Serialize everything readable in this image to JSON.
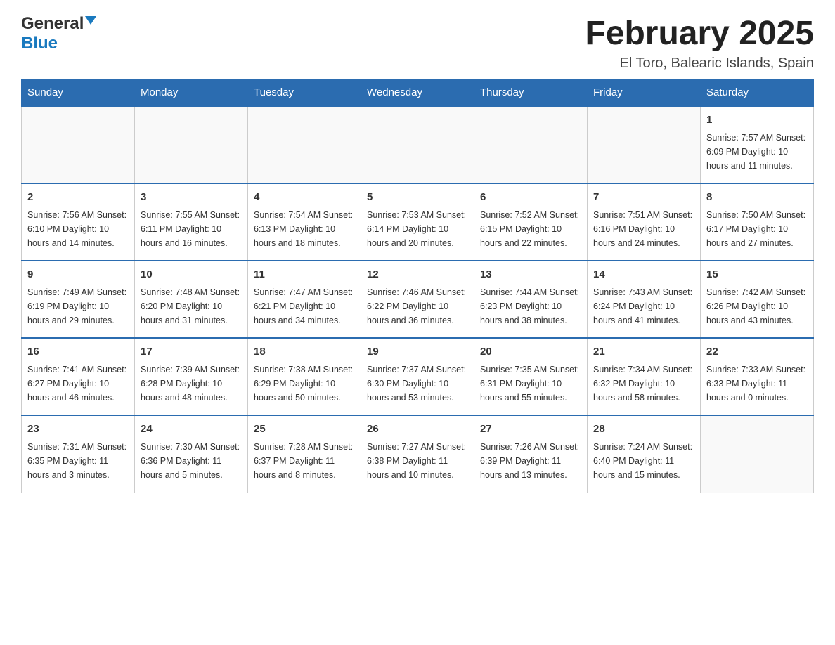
{
  "header": {
    "logo": {
      "general": "General",
      "blue": "Blue",
      "arrow_color": "#1a7abf"
    },
    "title": "February 2025",
    "location": "El Toro, Balearic Islands, Spain"
  },
  "calendar": {
    "days_of_week": [
      "Sunday",
      "Monday",
      "Tuesday",
      "Wednesday",
      "Thursday",
      "Friday",
      "Saturday"
    ],
    "weeks": [
      [
        {
          "day": "",
          "info": ""
        },
        {
          "day": "",
          "info": ""
        },
        {
          "day": "",
          "info": ""
        },
        {
          "day": "",
          "info": ""
        },
        {
          "day": "",
          "info": ""
        },
        {
          "day": "",
          "info": ""
        },
        {
          "day": "1",
          "info": "Sunrise: 7:57 AM\nSunset: 6:09 PM\nDaylight: 10 hours\nand 11 minutes."
        }
      ],
      [
        {
          "day": "2",
          "info": "Sunrise: 7:56 AM\nSunset: 6:10 PM\nDaylight: 10 hours\nand 14 minutes."
        },
        {
          "day": "3",
          "info": "Sunrise: 7:55 AM\nSunset: 6:11 PM\nDaylight: 10 hours\nand 16 minutes."
        },
        {
          "day": "4",
          "info": "Sunrise: 7:54 AM\nSunset: 6:13 PM\nDaylight: 10 hours\nand 18 minutes."
        },
        {
          "day": "5",
          "info": "Sunrise: 7:53 AM\nSunset: 6:14 PM\nDaylight: 10 hours\nand 20 minutes."
        },
        {
          "day": "6",
          "info": "Sunrise: 7:52 AM\nSunset: 6:15 PM\nDaylight: 10 hours\nand 22 minutes."
        },
        {
          "day": "7",
          "info": "Sunrise: 7:51 AM\nSunset: 6:16 PM\nDaylight: 10 hours\nand 24 minutes."
        },
        {
          "day": "8",
          "info": "Sunrise: 7:50 AM\nSunset: 6:17 PM\nDaylight: 10 hours\nand 27 minutes."
        }
      ],
      [
        {
          "day": "9",
          "info": "Sunrise: 7:49 AM\nSunset: 6:19 PM\nDaylight: 10 hours\nand 29 minutes."
        },
        {
          "day": "10",
          "info": "Sunrise: 7:48 AM\nSunset: 6:20 PM\nDaylight: 10 hours\nand 31 minutes."
        },
        {
          "day": "11",
          "info": "Sunrise: 7:47 AM\nSunset: 6:21 PM\nDaylight: 10 hours\nand 34 minutes."
        },
        {
          "day": "12",
          "info": "Sunrise: 7:46 AM\nSunset: 6:22 PM\nDaylight: 10 hours\nand 36 minutes."
        },
        {
          "day": "13",
          "info": "Sunrise: 7:44 AM\nSunset: 6:23 PM\nDaylight: 10 hours\nand 38 minutes."
        },
        {
          "day": "14",
          "info": "Sunrise: 7:43 AM\nSunset: 6:24 PM\nDaylight: 10 hours\nand 41 minutes."
        },
        {
          "day": "15",
          "info": "Sunrise: 7:42 AM\nSunset: 6:26 PM\nDaylight: 10 hours\nand 43 minutes."
        }
      ],
      [
        {
          "day": "16",
          "info": "Sunrise: 7:41 AM\nSunset: 6:27 PM\nDaylight: 10 hours\nand 46 minutes."
        },
        {
          "day": "17",
          "info": "Sunrise: 7:39 AM\nSunset: 6:28 PM\nDaylight: 10 hours\nand 48 minutes."
        },
        {
          "day": "18",
          "info": "Sunrise: 7:38 AM\nSunset: 6:29 PM\nDaylight: 10 hours\nand 50 minutes."
        },
        {
          "day": "19",
          "info": "Sunrise: 7:37 AM\nSunset: 6:30 PM\nDaylight: 10 hours\nand 53 minutes."
        },
        {
          "day": "20",
          "info": "Sunrise: 7:35 AM\nSunset: 6:31 PM\nDaylight: 10 hours\nand 55 minutes."
        },
        {
          "day": "21",
          "info": "Sunrise: 7:34 AM\nSunset: 6:32 PM\nDaylight: 10 hours\nand 58 minutes."
        },
        {
          "day": "22",
          "info": "Sunrise: 7:33 AM\nSunset: 6:33 PM\nDaylight: 11 hours\nand 0 minutes."
        }
      ],
      [
        {
          "day": "23",
          "info": "Sunrise: 7:31 AM\nSunset: 6:35 PM\nDaylight: 11 hours\nand 3 minutes."
        },
        {
          "day": "24",
          "info": "Sunrise: 7:30 AM\nSunset: 6:36 PM\nDaylight: 11 hours\nand 5 minutes."
        },
        {
          "day": "25",
          "info": "Sunrise: 7:28 AM\nSunset: 6:37 PM\nDaylight: 11 hours\nand 8 minutes."
        },
        {
          "day": "26",
          "info": "Sunrise: 7:27 AM\nSunset: 6:38 PM\nDaylight: 11 hours\nand 10 minutes."
        },
        {
          "day": "27",
          "info": "Sunrise: 7:26 AM\nSunset: 6:39 PM\nDaylight: 11 hours\nand 13 minutes."
        },
        {
          "day": "28",
          "info": "Sunrise: 7:24 AM\nSunset: 6:40 PM\nDaylight: 11 hours\nand 15 minutes."
        },
        {
          "day": "",
          "info": ""
        }
      ]
    ]
  }
}
